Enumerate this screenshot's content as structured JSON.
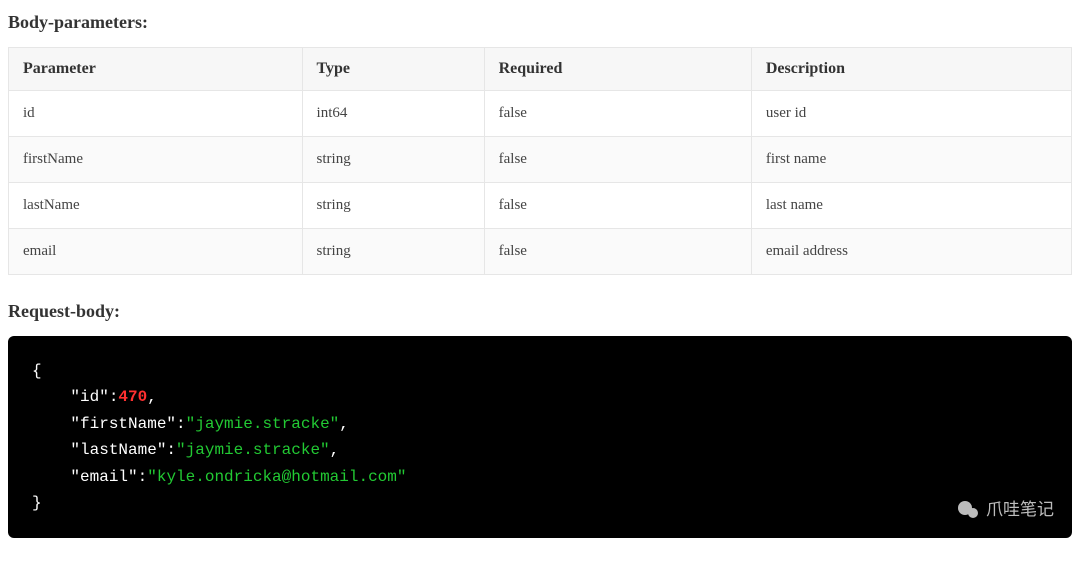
{
  "sections": {
    "body_params_title": "Body-parameters:",
    "request_body_title": "Request-body:"
  },
  "table": {
    "headers": [
      "Parameter",
      "Type",
      "Required",
      "Description"
    ],
    "rows": [
      {
        "param": "id",
        "type": "int64",
        "required": "false",
        "desc": "user id"
      },
      {
        "param": "firstName",
        "type": "string",
        "required": "false",
        "desc": "first name"
      },
      {
        "param": "lastName",
        "type": "string",
        "required": "false",
        "desc": "last name"
      },
      {
        "param": "email",
        "type": "string",
        "required": "false",
        "desc": "email address"
      }
    ]
  },
  "request_body_json": {
    "fields": [
      {
        "key": "id",
        "value": 470,
        "kind": "number"
      },
      {
        "key": "firstName",
        "value": "jaymie.stracke",
        "kind": "string"
      },
      {
        "key": "lastName",
        "value": "jaymie.stracke",
        "kind": "string"
      },
      {
        "key": "email",
        "value": "kyle.ondricka@hotmail.com",
        "kind": "string"
      }
    ]
  },
  "watermark": {
    "text": "爪哇笔记"
  }
}
